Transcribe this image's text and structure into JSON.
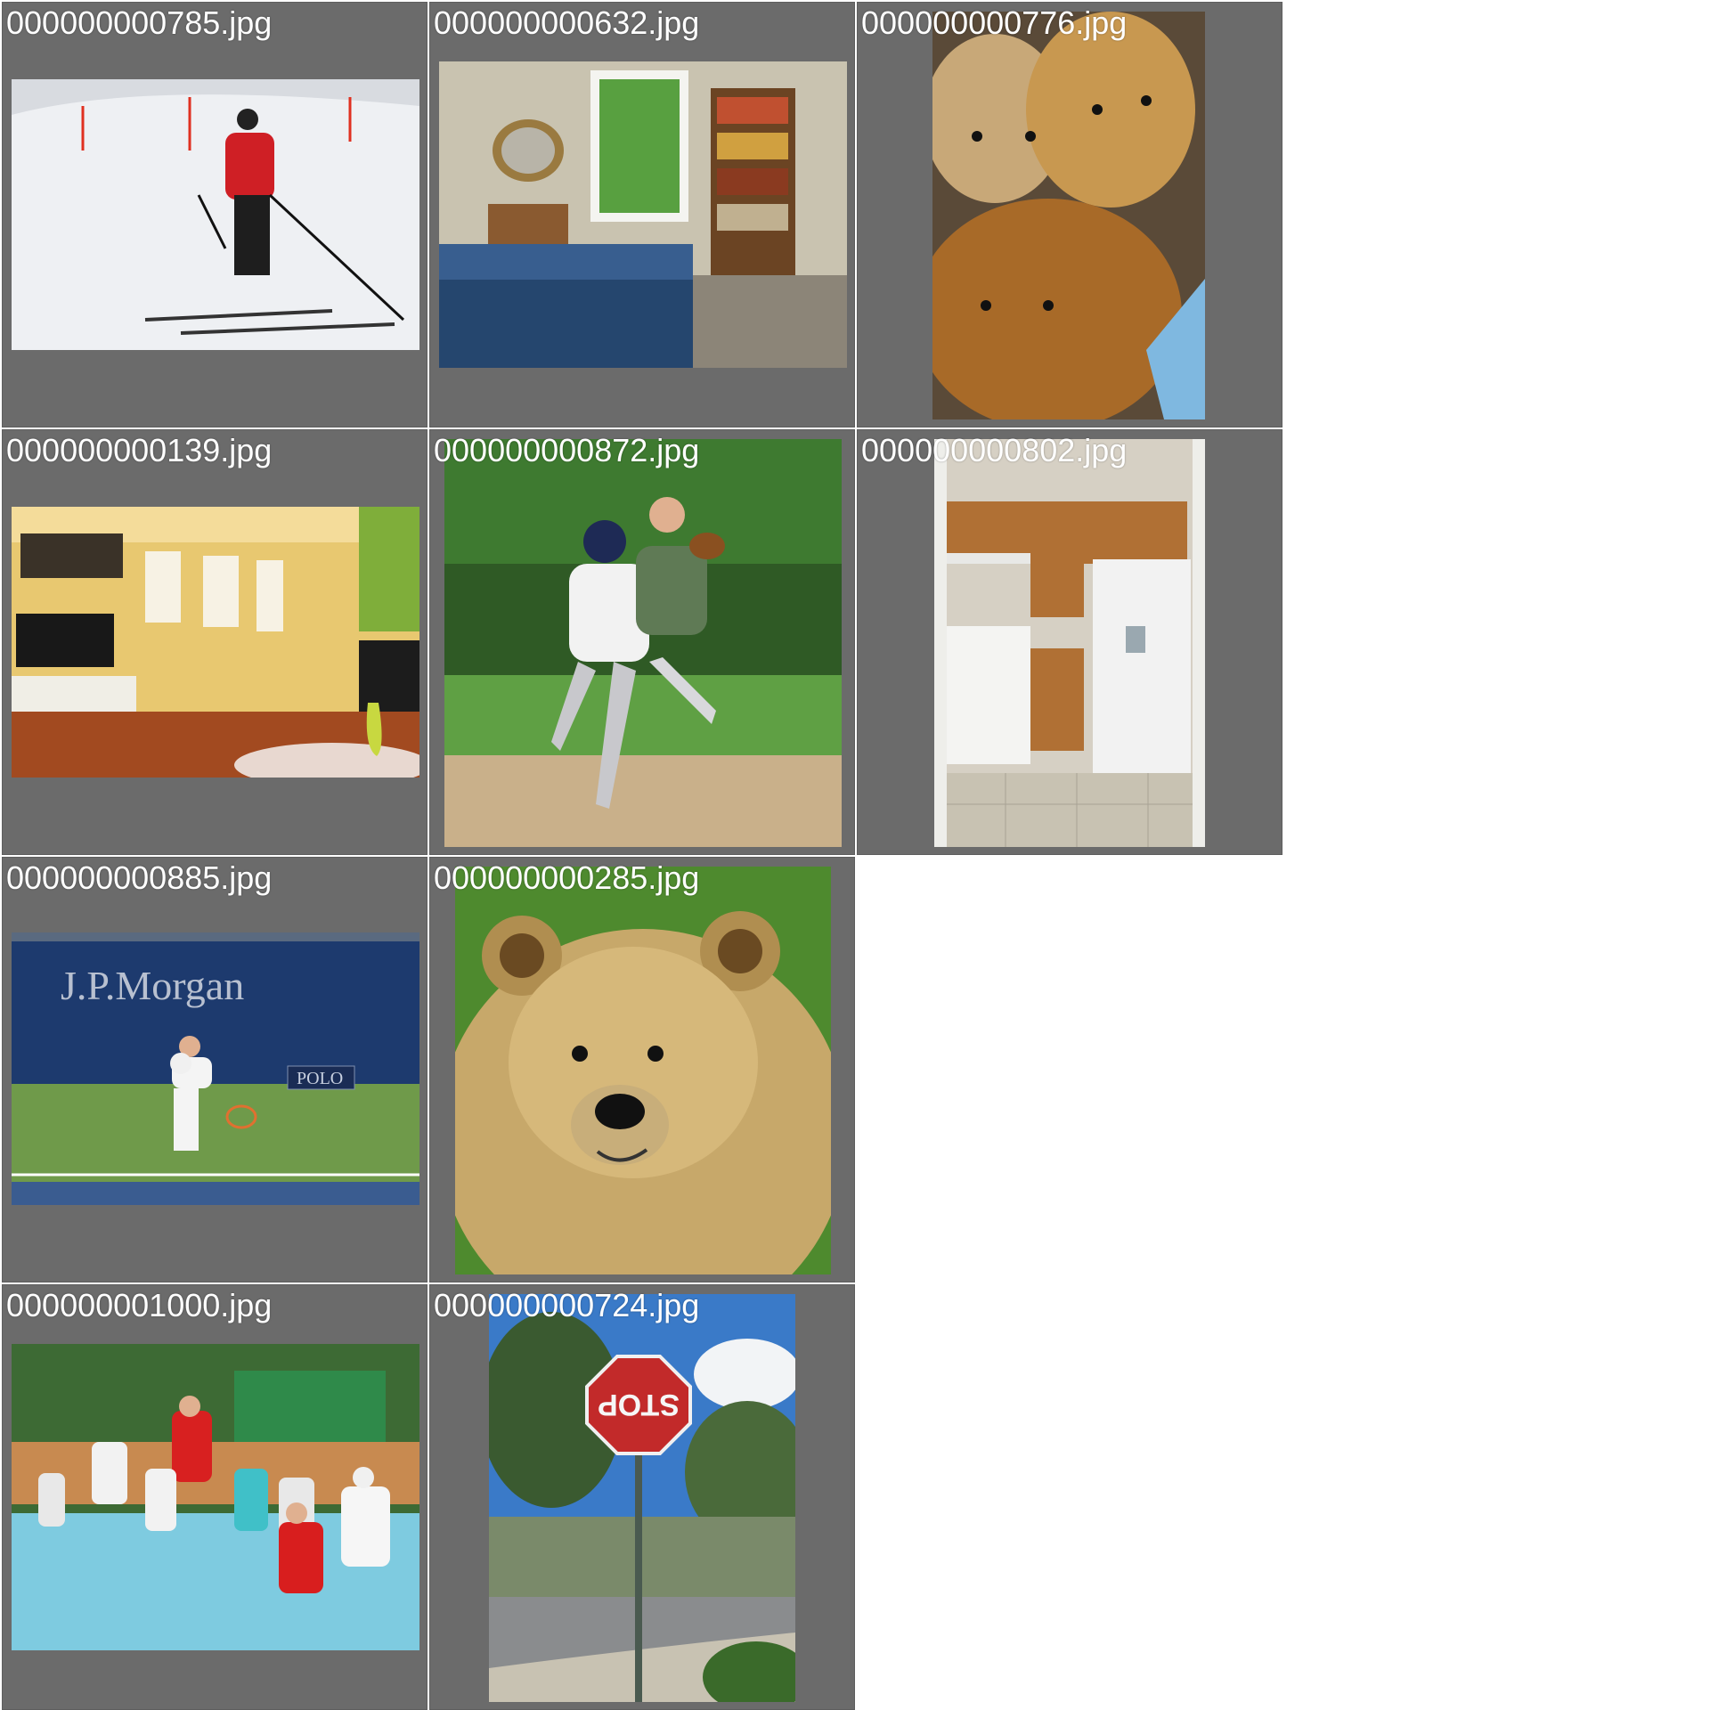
{
  "gallery": {
    "tiles": [
      {
        "filename": "000000000785.jpg",
        "subject": "skier"
      },
      {
        "filename": "000000000632.jpg",
        "subject": "bedroom"
      },
      {
        "filename": "000000000776.jpg",
        "subject": "teddy-bears"
      },
      {
        "filename": "000000000139.jpg",
        "subject": "living-room"
      },
      {
        "filename": "000000000872.jpg",
        "subject": "baseball"
      },
      {
        "filename": "000000000802.jpg",
        "subject": "kitchen"
      },
      {
        "filename": "000000000885.jpg",
        "subject": "tennis",
        "banner_text": "J.P.Morgan",
        "sign_text": "POLO"
      },
      {
        "filename": "000000000285.jpg",
        "subject": "bear"
      },
      {
        "filename": "000000001000.jpg",
        "subject": "tennis-kids"
      },
      {
        "filename": "000000000724.jpg",
        "subject": "stop-sign",
        "sign_text": "STOP"
      }
    ]
  },
  "colors": {
    "tile_background": "#6b6b6b",
    "page_background": "#ffffff",
    "label_text": "#ffffff"
  }
}
